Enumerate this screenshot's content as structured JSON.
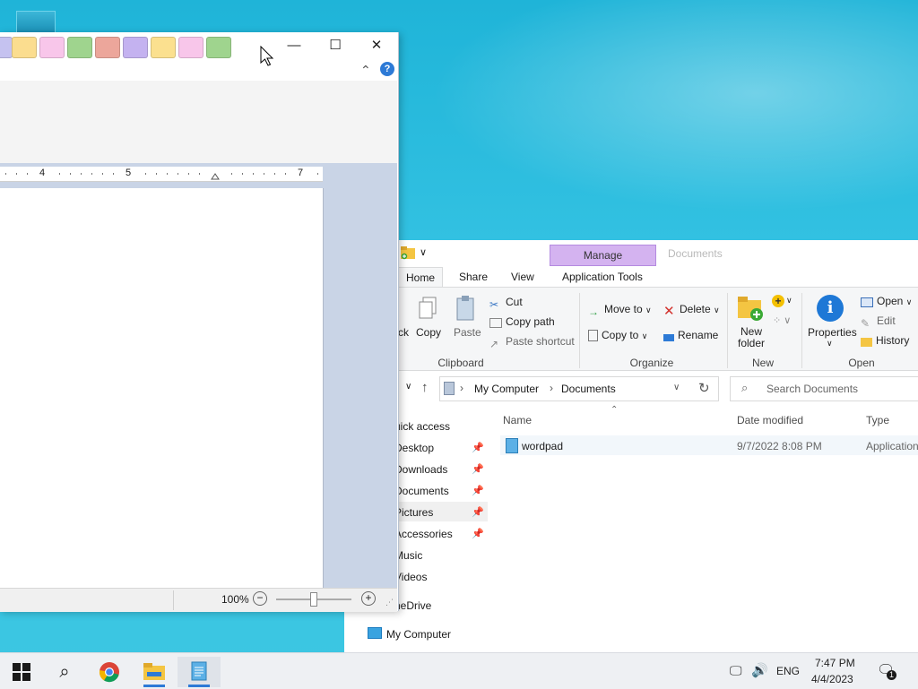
{
  "wordpad": {
    "ruler_numbers": [
      "4",
      "5",
      "7"
    ],
    "zoom": "100%",
    "swatch_colors": [
      "#c5c2f0",
      "#fbdd8f",
      "#f8c6ea",
      "#9fd48e",
      "#eca69b",
      "#c4b2f0",
      "#fbe08f",
      "#f8c6ea",
      "#9fd48e"
    ]
  },
  "explorer": {
    "tool_label": "Manage",
    "title": "Documents",
    "tabs": [
      "Home",
      "Share",
      "View",
      "Application Tools"
    ],
    "clipboard": {
      "cut_partial": "ck",
      "copy": "Copy",
      "paste": "Paste",
      "cut": "Cut",
      "copy_path": "Copy path",
      "paste_shortcut": "Paste shortcut",
      "label": "Clipboard"
    },
    "organize": {
      "move_to": "Move to",
      "copy_to": "Copy to",
      "delete": "Delete",
      "rename": "Rename",
      "label": "Organize"
    },
    "new": {
      "new_folder_line1": "New",
      "new_folder_line2": "folder",
      "label": "New"
    },
    "open": {
      "properties": "Properties",
      "open": "Open",
      "edit": "Edit",
      "history": "History",
      "label": "Open"
    },
    "breadcrumb": [
      "My Computer",
      "Documents"
    ],
    "search_placeholder": "Search Documents",
    "nav": [
      "uick access",
      "Desktop",
      "Downloads",
      "Documents",
      "Pictures",
      "Accessories",
      "Music",
      "Videos",
      "neDrive",
      "My Computer"
    ],
    "columns": {
      "name": "Name",
      "date": "Date modified",
      "type": "Type"
    },
    "files": [
      {
        "name": "wordpad",
        "date": "9/7/2022 8:08 PM",
        "type": "Application"
      }
    ]
  },
  "taskbar": {
    "language": "ENG",
    "time": "7:47 PM",
    "date": "4/4/2023",
    "notification_count": "1"
  }
}
